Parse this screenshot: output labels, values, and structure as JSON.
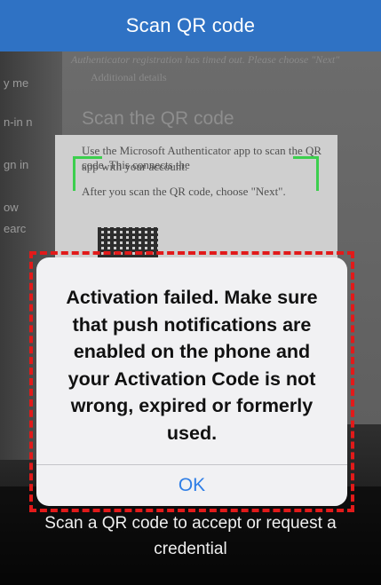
{
  "header": {
    "title": "Scan QR code"
  },
  "camera_view": {
    "background_text": {
      "top_line": "Authenticator registration has timed out. Please choose \"Next\"",
      "link": "Additional details",
      "heading": "Scan the QR code",
      "instruction_1": "Use the Microsoft Authenticator app to scan the QR code. This connects the",
      "instruction_1b": "app with your account.",
      "instruction_2": "After you scan the QR code, choose \"Next\".",
      "left_fragments": [
        "y me",
        "n-in n",
        "gn in",
        "ow",
        "earc"
      ]
    }
  },
  "alert": {
    "message": "Activation failed. Make sure that push notifications are enabled on the phone and your Activation Code is not wrong, expired or formerly used.",
    "ok_label": "OK"
  },
  "instruction": {
    "text": "Scan a QR code to accept or request a credential"
  },
  "colors": {
    "header": "#2f72c4",
    "highlight_border": "#e21a1a",
    "ok_text": "#2f7ee6",
    "scan_corners": "#3ccf4e"
  }
}
